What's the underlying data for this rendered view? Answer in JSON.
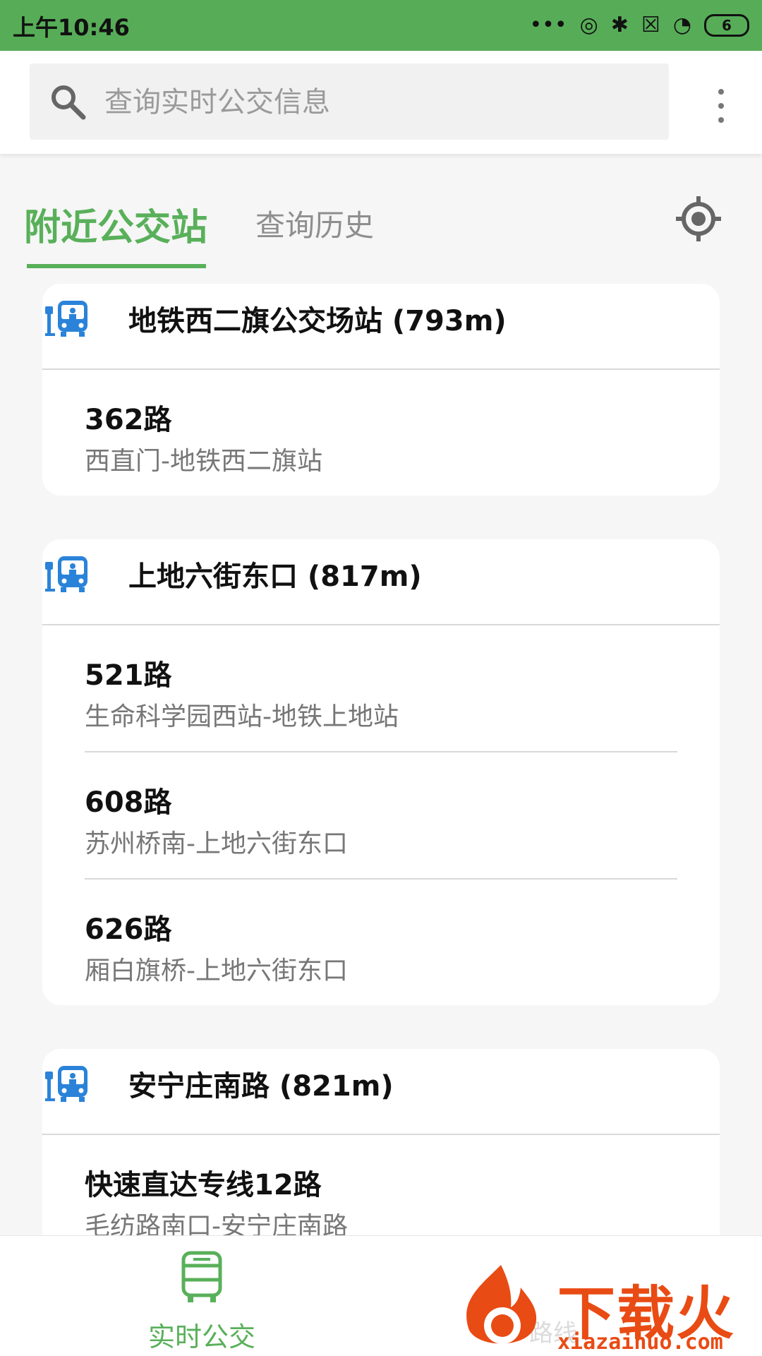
{
  "status_bar": {
    "time": "上午10:46",
    "battery": "6"
  },
  "search": {
    "placeholder": "查询实时公交信息"
  },
  "tabs": {
    "active": "附近公交站",
    "history": "查询历史"
  },
  "stations": [
    {
      "name": "地铁西二旗公交场站 (793m)",
      "routes": [
        {
          "number": "362路",
          "direction": "西直门-地铁西二旗站"
        }
      ]
    },
    {
      "name": "上地六街东口 (817m)",
      "routes": [
        {
          "number": "521路",
          "direction": "生命科学园西站-地铁上地站"
        },
        {
          "number": "608路",
          "direction": "苏州桥南-上地六街东口"
        },
        {
          "number": "626路",
          "direction": "厢白旗桥-上地六街东口"
        }
      ]
    },
    {
      "name": "安宁庄南路 (821m)",
      "routes": [
        {
          "number": "快速直达专线12路",
          "direction": "毛纺路南口-安宁庄南路"
        }
      ]
    }
  ],
  "bottom_nav": {
    "realtime_label": "实时公交",
    "second_label": "路线"
  },
  "watermark": {
    "text": "下载火",
    "sub": "xiazaihuo.com"
  },
  "colors": {
    "accent": "#59b05a",
    "status_bar": "#57ad57"
  }
}
